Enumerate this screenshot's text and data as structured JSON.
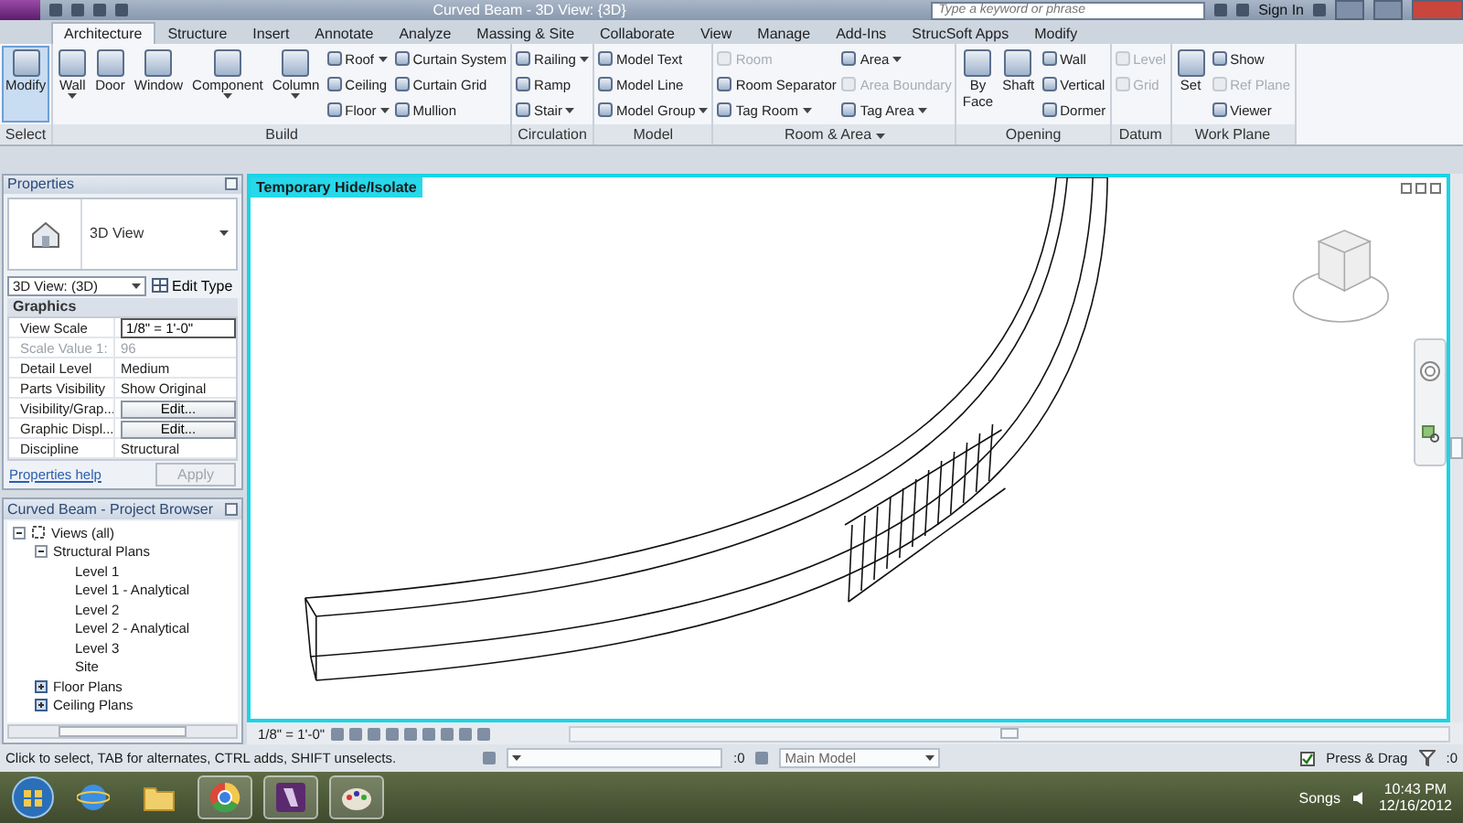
{
  "title_bar": {
    "title": "Curved Beam - 3D View: {3D}",
    "search": {
      "placeholder": "Type a keyword or phrase"
    },
    "sign_in": "Sign In"
  },
  "tabs": [
    {
      "label": "Architecture",
      "selected": true
    },
    {
      "label": "Structure",
      "selected": false
    },
    {
      "label": "Insert",
      "selected": false
    },
    {
      "label": "Annotate",
      "selected": false
    },
    {
      "label": "Analyze",
      "selected": false
    },
    {
      "label": "Massing & Site",
      "selected": false
    },
    {
      "label": "Collaborate",
      "selected": false
    },
    {
      "label": "View",
      "selected": false
    },
    {
      "label": "Manage",
      "selected": false
    },
    {
      "label": "Add-Ins",
      "selected": false
    },
    {
      "label": "StrucSoft Apps",
      "selected": false
    },
    {
      "label": "Modify",
      "selected": false
    }
  ],
  "ribbon": [
    {
      "label": "Select",
      "dropdown": false,
      "items": [
        {
          "kind": "large",
          "label": "Modify",
          "selected": true,
          "disabled": false,
          "dropdown": false
        }
      ]
    },
    {
      "label": "Build",
      "dropdown": false,
      "items": [
        {
          "kind": "large",
          "label": "Wall",
          "selected": false,
          "disabled": false,
          "dropdown": true
        },
        {
          "kind": "large",
          "label": "Door",
          "selected": false,
          "disabled": false,
          "dropdown": false
        },
        {
          "kind": "large",
          "label": "Window",
          "selected": false,
          "disabled": false,
          "dropdown": false
        },
        {
          "kind": "large",
          "label": "Component",
          "selected": false,
          "disabled": false,
          "dropdown": true
        },
        {
          "kind": "large",
          "label": "Column",
          "selected": false,
          "disabled": false,
          "dropdown": true
        },
        {
          "kind": "small",
          "label": "Roof",
          "selected": false,
          "disabled": false,
          "dropdown": true
        },
        {
          "kind": "small",
          "label": "Ceiling",
          "selected": false,
          "disabled": false,
          "dropdown": false
        },
        {
          "kind": "small",
          "label": "Floor",
          "selected": false,
          "disabled": false,
          "dropdown": true
        },
        {
          "kind": "small",
          "label": "Curtain System",
          "selected": false,
          "disabled": false,
          "dropdown": false
        },
        {
          "kind": "small",
          "label": "Curtain Grid",
          "selected": false,
          "disabled": false,
          "dropdown": false
        },
        {
          "kind": "small",
          "label": "Mullion",
          "selected": false,
          "disabled": false,
          "dropdown": false
        }
      ]
    },
    {
      "label": "Circulation",
      "dropdown": false,
      "items": [
        {
          "kind": "small",
          "label": "Railing",
          "selected": false,
          "disabled": false,
          "dropdown": true
        },
        {
          "kind": "small",
          "label": "Ramp",
          "selected": false,
          "disabled": false,
          "dropdown": false
        },
        {
          "kind": "small",
          "label": "Stair",
          "selected": false,
          "disabled": false,
          "dropdown": true
        }
      ]
    },
    {
      "label": "Model",
      "dropdown": false,
      "items": [
        {
          "kind": "small",
          "label": "Model Text",
          "selected": false,
          "disabled": false,
          "dropdown": false
        },
        {
          "kind": "small",
          "label": "Model Line",
          "selected": false,
          "disabled": false,
          "dropdown": false
        },
        {
          "kind": "small",
          "label": "Model Group",
          "selected": false,
          "disabled": false,
          "dropdown": true
        }
      ]
    },
    {
      "label": "Room & Area",
      "dropdown": true,
      "items": [
        {
          "kind": "small",
          "label": "Room",
          "selected": false,
          "disabled": true,
          "dropdown": false
        },
        {
          "kind": "small",
          "label": "Room Separator",
          "selected": false,
          "disabled": false,
          "dropdown": false
        },
        {
          "kind": "small",
          "label": "Tag Room",
          "selected": false,
          "disabled": false,
          "dropdown": true
        },
        {
          "kind": "small",
          "label": "Area",
          "selected": false,
          "disabled": false,
          "dropdown": true
        },
        {
          "kind": "small",
          "label": "Area Boundary",
          "selected": false,
          "disabled": true,
          "dropdown": false
        },
        {
          "kind": "small",
          "label": "Tag Area",
          "selected": false,
          "disabled": false,
          "dropdown": true
        }
      ]
    },
    {
      "label": "Opening",
      "dropdown": false,
      "items": [
        {
          "kind": "large",
          "label": "By Face",
          "selected": false,
          "disabled": false,
          "dropdown": false
        },
        {
          "kind": "large",
          "label": "Shaft",
          "selected": false,
          "disabled": false,
          "dropdown": false
        },
        {
          "kind": "small",
          "label": "Wall",
          "selected": false,
          "disabled": false,
          "dropdown": false
        },
        {
          "kind": "small",
          "label": "Vertical",
          "selected": false,
          "disabled": false,
          "dropdown": false
        },
        {
          "kind": "small",
          "label": "Dormer",
          "selected": false,
          "disabled": false,
          "dropdown": false
        }
      ]
    },
    {
      "label": "Datum",
      "dropdown": false,
      "items": [
        {
          "kind": "small",
          "label": "Level",
          "selected": false,
          "disabled": true,
          "dropdown": false
        },
        {
          "kind": "small",
          "label": "Grid",
          "selected": false,
          "disabled": true,
          "dropdown": false
        }
      ]
    },
    {
      "label": "Work Plane",
      "dropdown": false,
      "items": [
        {
          "kind": "large",
          "label": "Set",
          "selected": false,
          "disabled": false,
          "dropdown": false
        },
        {
          "kind": "small",
          "label": "Show",
          "selected": false,
          "disabled": false,
          "dropdown": false
        },
        {
          "kind": "small",
          "label": "Ref Plane",
          "selected": false,
          "disabled": true,
          "dropdown": false
        },
        {
          "kind": "small",
          "label": "Viewer",
          "selected": false,
          "disabled": false,
          "dropdown": false
        }
      ]
    }
  ],
  "properties": {
    "title": "Properties",
    "type_name": "3D View",
    "instance": "3D View: (3D)",
    "edit_type": "Edit Type",
    "section": "Graphics",
    "rows": [
      {
        "kind": "field",
        "name": "View Scale",
        "value": "1/8\" = 1'-0\"",
        "disabled": false
      },
      {
        "kind": "text",
        "name": "Scale Value    1:",
        "value": "96",
        "disabled": true
      },
      {
        "kind": "text",
        "name": "Detail Level",
        "value": "Medium",
        "disabled": false
      },
      {
        "kind": "text",
        "name": "Parts Visibility",
        "value": "Show Original",
        "disabled": false
      },
      {
        "kind": "button",
        "name": "Visibility/Grap...",
        "value": "Edit...",
        "disabled": false
      },
      {
        "kind": "button",
        "name": "Graphic Displ...",
        "value": "Edit...",
        "disabled": false
      },
      {
        "kind": "text",
        "name": "Discipline",
        "value": "Structural",
        "disabled": false
      }
    ],
    "help": "Properties help",
    "apply": {
      "label": "Apply",
      "disabled": true
    }
  },
  "browser": {
    "title": "Curved Beam - Project Browser",
    "tree": [
      {
        "label": "Views (all)",
        "expanded": true,
        "children": [
          {
            "label": "Structural Plans",
            "expanded": true,
            "children": [
              {
                "label": "Level 1"
              },
              {
                "label": "Level 1 - Analytical"
              },
              {
                "label": "Level 2"
              },
              {
                "label": "Level 2 - Analytical"
              },
              {
                "label": "Level 3"
              },
              {
                "label": "Site"
              }
            ]
          },
          {
            "label": "Floor Plans",
            "expanded": false
          },
          {
            "label": "Ceiling Plans",
            "expanded": false
          }
        ]
      }
    ]
  },
  "viewport": {
    "title": "Temporary Hide/Isolate",
    "scale": "1/8\" = 1'-0\""
  },
  "status_bar": {
    "hint": "Click to select, TAB for alternates, CTRL adds, SHIFT unselects.",
    "selection_count": ":0",
    "workset": "Main Model",
    "press_drag": {
      "label": "Press & Drag",
      "checked": true
    },
    "filter_count": ":0"
  },
  "taskbar": {
    "tray_label": "Songs",
    "time": "10:43 PM",
    "date": "12/16/2012"
  }
}
